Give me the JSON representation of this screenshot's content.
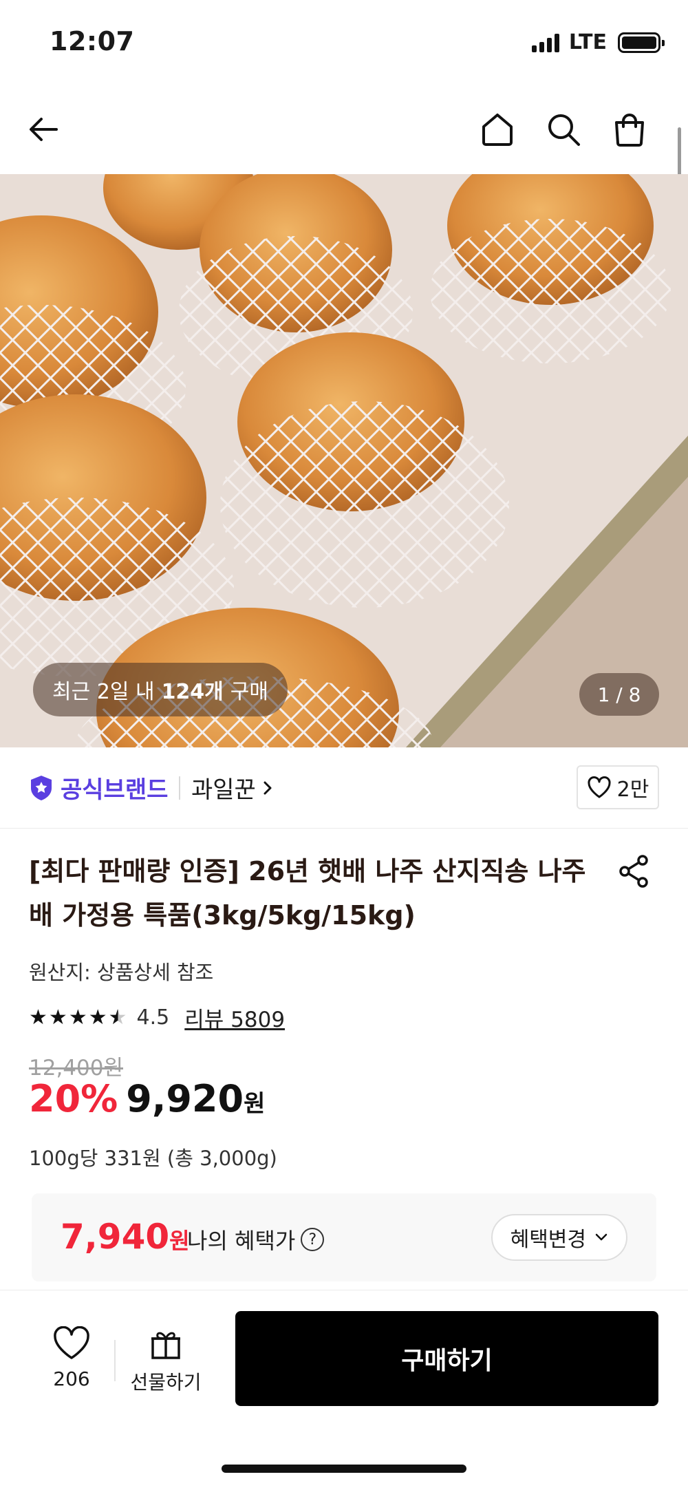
{
  "status_bar": {
    "time": "12:07",
    "network": "LTE"
  },
  "nav": {
    "icons": [
      "back-arrow-icon",
      "home-icon",
      "search-icon",
      "shopping-bag-icon"
    ]
  },
  "hero": {
    "badge_prefix": "최근 2일 내",
    "badge_count": "124개",
    "badge_suffix": "구매",
    "counter": "1 / 8"
  },
  "brand": {
    "official_label": "공식브랜드",
    "store_name": "과일꾼",
    "like_count": "2만"
  },
  "product": {
    "title": "[최다 판매량 인증] 26년 햇배 나주 산지직송 나주배 가정용 특품(3kg/5kg/15kg)",
    "origin": "원산지: 상품상세 참조",
    "rating": "4.5",
    "rating_value": 4.5,
    "review_label": "리뷰 5809",
    "original_price": "12,400원",
    "discount": "20%",
    "price": "9,920",
    "price_unit": "원",
    "unit_price": "100g당 331원 (총 3,000g)"
  },
  "benefit": {
    "price": "7,940",
    "price_unit": "원",
    "label": "나의 혜택가",
    "help": "?",
    "change_label": "혜택변경"
  },
  "bottom_bar": {
    "wish_count": "206",
    "gift_label": "선물하기",
    "buy_label": "구매하기"
  },
  "colors": {
    "accent_red": "#f0263a",
    "brand_purple": "#5a3fe0",
    "buy_button": "#000000"
  }
}
